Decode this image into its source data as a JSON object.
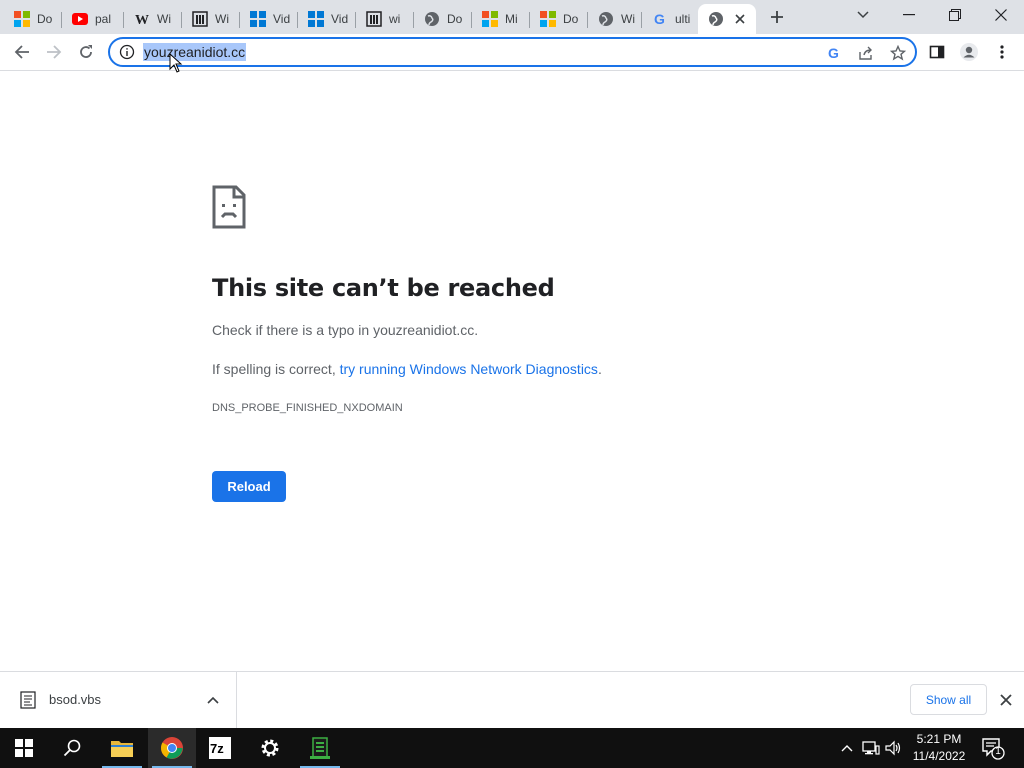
{
  "browser": {
    "tabs": [
      {
        "title": "Do",
        "favicon": "microsoft-icon"
      },
      {
        "title": "pal",
        "favicon": "youtube-icon"
      },
      {
        "title": "Wi",
        "favicon": "wikipedia-icon"
      },
      {
        "title": "Wi",
        "favicon": "museum-icon"
      },
      {
        "title": "Vid",
        "favicon": "windows-icon"
      },
      {
        "title": "Vid",
        "favicon": "windows-icon"
      },
      {
        "title": "wi",
        "favicon": "museum-icon"
      },
      {
        "title": "Do",
        "favicon": "globe-icon"
      },
      {
        "title": "Mi",
        "favicon": "microsoft-icon"
      },
      {
        "title": "Do",
        "favicon": "microsoft-icon"
      },
      {
        "title": "Wi",
        "favicon": "globe-icon"
      },
      {
        "title": "ulti",
        "favicon": "google-icon"
      },
      {
        "title": "",
        "favicon": "globe-icon",
        "active": true
      }
    ],
    "omnibox": {
      "url": "youzreanidiot.cc"
    }
  },
  "error_page": {
    "title": "This site can’t be reached",
    "line1": "Check if there is a typo in youzreanidiot.cc.",
    "line2_prefix": "If spelling is correct, ",
    "line2_link": "try running Windows Network Diagnostics",
    "line2_suffix": ".",
    "error_code": "DNS_PROBE_FINISHED_NXDOMAIN",
    "reload_label": "Reload"
  },
  "download_shelf": {
    "filename": "bsod.vbs",
    "show_all_label": "Show all"
  },
  "taskbar": {
    "time": "5:21 PM",
    "date": "11/4/2022",
    "notification_count": "1"
  },
  "colors": {
    "accent": "#1a73e8",
    "tabstrip": "#dee1e6",
    "taskbar": "#101010"
  }
}
